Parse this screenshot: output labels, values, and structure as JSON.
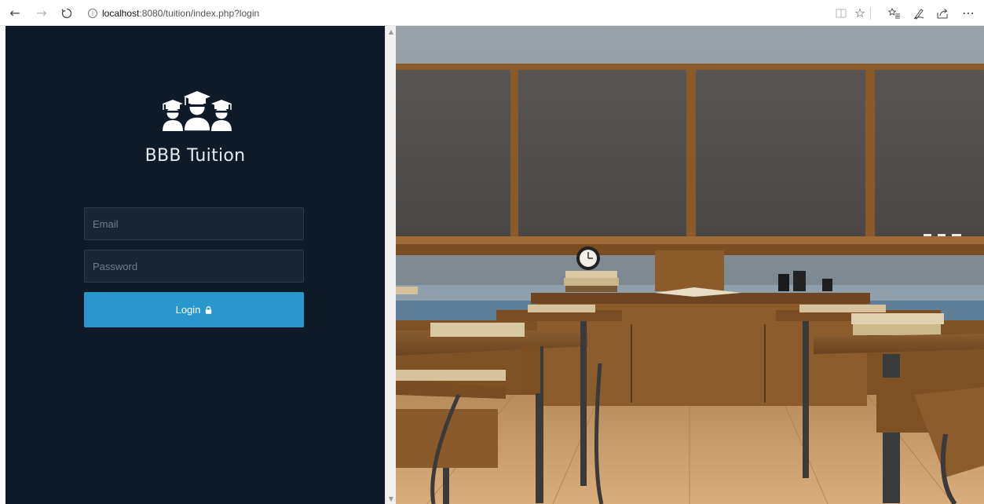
{
  "browser": {
    "url_host": "localhost",
    "url_rest": ":8080/tuition/index.php?login",
    "icons": [
      "back-arrow-icon",
      "forward-arrow-icon",
      "refresh-icon",
      "info-icon",
      "reading-view-icon",
      "favorite-star-icon",
      "favorites-list-icon",
      "pen-icon",
      "share-icon",
      "more-icon"
    ]
  },
  "app": {
    "brand_name": "BBB Tuition",
    "logo_icon": "graduates-icon"
  },
  "login_form": {
    "email_placeholder": "Email",
    "email_value": "",
    "password_placeholder": "Password",
    "password_value": "",
    "login_label": "Login",
    "login_icon": "lock-icon"
  },
  "colors": {
    "panel_background": "#0e1a28",
    "field_background": "#1a2634",
    "button_accent": "#2a97cc"
  }
}
